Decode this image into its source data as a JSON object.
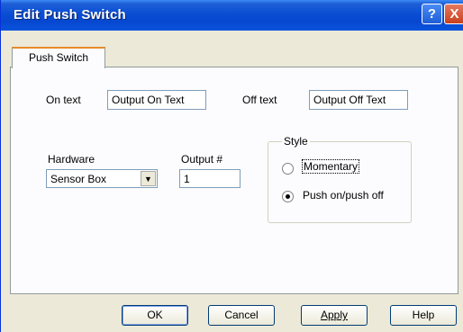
{
  "window": {
    "title": "Edit Push Switch"
  },
  "title_buttons": {
    "help": "?",
    "close": "X"
  },
  "tabs": [
    {
      "label": "Push Switch"
    }
  ],
  "form": {
    "on_text_label": "On text",
    "on_text_value": "Output On Text",
    "off_text_label": "Off text",
    "off_text_value": "Output Off Text",
    "hardware_label": "Hardware",
    "hardware_value": "Sensor Box",
    "output_label": "Output #",
    "output_value": "1"
  },
  "style_group": {
    "legend": "Style",
    "options": [
      {
        "label": "Momentary",
        "checked": false
      },
      {
        "label": "Push on/push off",
        "checked": true
      }
    ]
  },
  "buttons": {
    "ok": "OK",
    "cancel": "Cancel",
    "apply": "Apply",
    "help": "Help"
  }
}
